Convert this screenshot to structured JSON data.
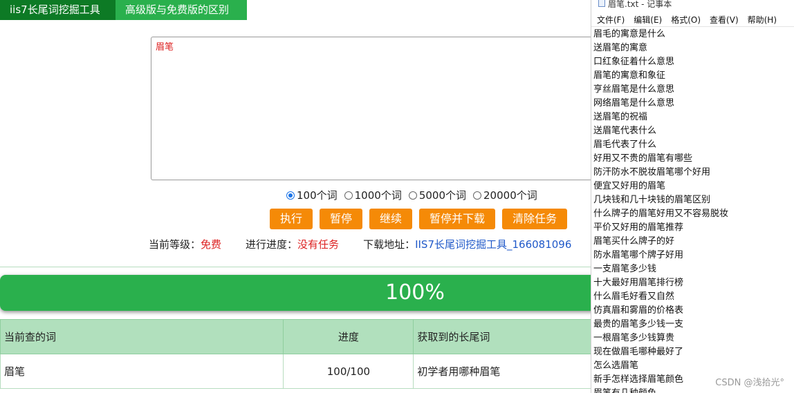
{
  "tabs": {
    "tool": "iis7长尾词挖掘工具",
    "compare": "高级版与免费版的区别"
  },
  "keyword_input": {
    "value": "眉笔"
  },
  "word_count_options": [
    {
      "label": "100个词",
      "selected": true
    },
    {
      "label": "1000个词",
      "selected": false
    },
    {
      "label": "5000个词",
      "selected": false
    },
    {
      "label": "20000个词",
      "selected": false
    }
  ],
  "buttons": {
    "execute": "执行",
    "pause": "暂停",
    "continue": "继续",
    "pause_download": "暂停并下载",
    "clear": "清除任务"
  },
  "status": {
    "level_label": "当前等级：",
    "level_value": "免费",
    "progress_label": "进行进度：",
    "progress_value": "没有任务",
    "download_label": "下载地址：",
    "download_link": "IIS7长尾词挖掘工具_166081096"
  },
  "progress": {
    "text": "100%",
    "fraction": 1.0
  },
  "table": {
    "headers": [
      "当前查的词",
      "进度",
      "获取到的长尾词"
    ],
    "rows": [
      [
        "眉笔",
        "100/100",
        "初学者用哪种眉笔"
      ]
    ]
  },
  "notepad": {
    "title": "眉笔.txt - 记事本",
    "menu": [
      "文件(F)",
      "编辑(E)",
      "格式(O)",
      "查看(V)",
      "帮助(H)"
    ],
    "lines": [
      "眉毛的寓意是什么",
      "送眉笔的寓意",
      "口红象征着什么意思",
      "眉笔的寓意和象征",
      "亨丝眉笔是什么意思",
      "网络眉笔是什么意思",
      "送眉笔的祝福",
      "送眉笔代表什么",
      "眉毛代表了什么",
      "好用又不贵的眉笔有哪些",
      "防汗防水不脱妆眉笔哪个好用",
      "便宜又好用的眉笔",
      "几块钱和几十块钱的眉笔区别",
      "什么牌子的眉笔好用又不容易脱妆",
      "平价又好用的眉笔推荐",
      "眉笔买什么牌子的好",
      "防水眉笔哪个牌子好用",
      "一支眉笔多少钱",
      "十大最好用眉笔排行榜",
      "什么眉毛好看又自然",
      "仿真眉和雾眉的价格表",
      "最贵的眉笔多少钱一支",
      "一根眉笔多少钱算贵",
      "现在做眉毛哪种最好了",
      "怎么选眉笔",
      "新手怎样选择眉笔颜色",
      "眉笔有几种颜色"
    ]
  },
  "watermark": "CSDN @浅拾光°",
  "colors": {
    "dark_green": "#0d7a25",
    "green": "#2ab04d",
    "orange": "#f58a07",
    "red": "#dd2222",
    "link_blue": "#2059c9",
    "table_header": "#b1e0bd"
  }
}
